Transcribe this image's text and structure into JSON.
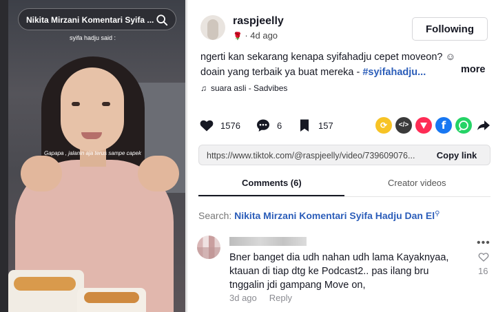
{
  "video": {
    "search_text": "Nikita Mirzani Komentari Syifa ...",
    "said_label": "syifa hadju said :",
    "caption": "Gapapa , jalanin aja terus sampe capek"
  },
  "author": {
    "username": "raspjeelly",
    "badge": "🌹",
    "time": "· 4d ago",
    "follow_label": "Following"
  },
  "post": {
    "line1": "ngerti kan sekarang kenapa syifahadju cepet moveon? ☺",
    "line2_text": "doain yang terbaik ya buat mereka - ",
    "hashtag": "#syifahadju...",
    "more_label": "more",
    "music": "suara asli - Sadvibes"
  },
  "stats": {
    "likes": "1576",
    "comments": "6",
    "saves": "157"
  },
  "share_icons": [
    "repost-icon",
    "embed-icon",
    "send-icon",
    "facebook-icon",
    "whatsapp-icon",
    "share-arrow-icon"
  ],
  "link": {
    "url": "https://www.tiktok.com/@raspjeelly/video/739609076...",
    "copy_label": "Copy link"
  },
  "tabs": {
    "comments_label": "Comments (6)",
    "creator_label": "Creator videos"
  },
  "search": {
    "prefix": "Search: ",
    "query": "Nikita Mirzani Komentari Syifa Hadju Dan El"
  },
  "comment": {
    "text": "Bner banget dia udh nahan udh lama Kayaknyaa, ktauan di tiap dtg ke Podcast2.. pas ilang bru tnggalin jdi gampang Move on,",
    "time": "3d ago",
    "reply_label": "Reply",
    "likes": "16"
  },
  "colors": {
    "hashtag": "#2b5db9",
    "repost": "#f7c325",
    "embed": "#3a3a3a",
    "send": "#fe2c55",
    "facebook": "#1877f2",
    "whatsapp": "#25d366"
  }
}
